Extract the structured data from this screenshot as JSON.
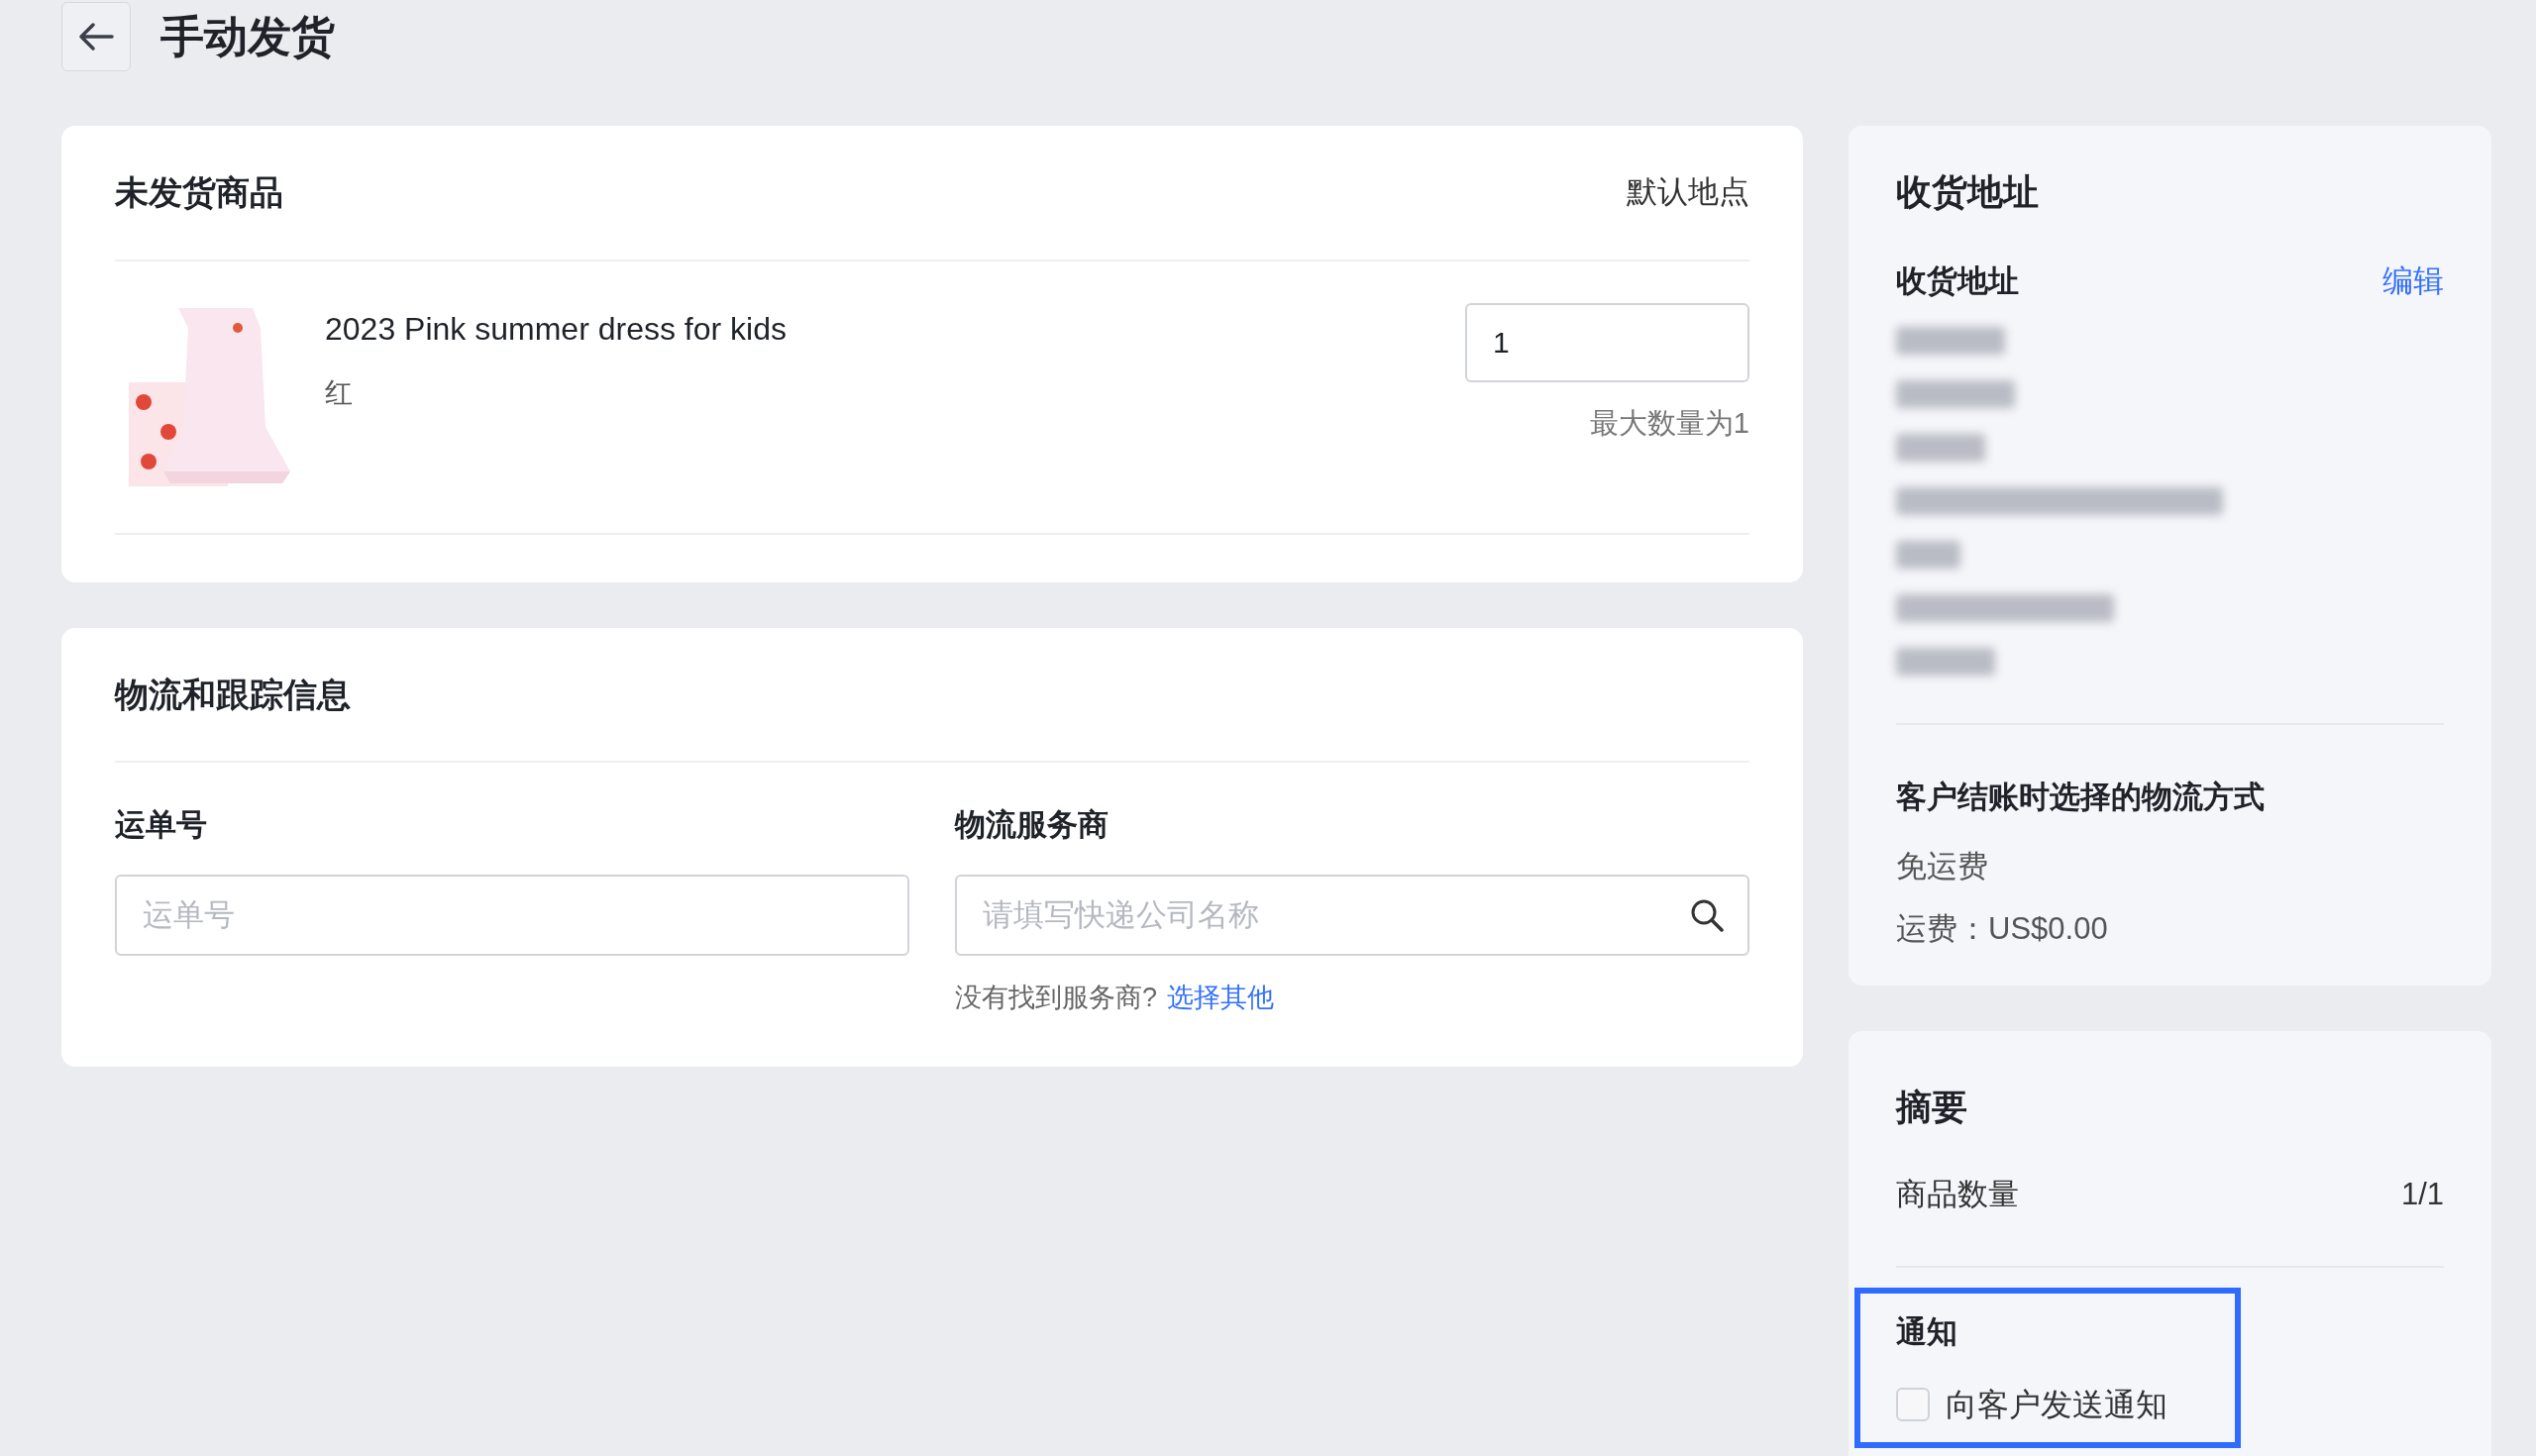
{
  "page": {
    "title": "手动发货"
  },
  "unfulfilled": {
    "title": "未发货商品",
    "location": "默认地点",
    "items": [
      {
        "name": "2023 Pink summer dress for kids",
        "variant": "红",
        "quantity": "1",
        "hint": "最大数量为1"
      }
    ]
  },
  "shipping": {
    "title": "物流和跟踪信息",
    "fields": [
      {
        "label": "运单号",
        "placeholder": "运单号",
        "kind": "text"
      },
      {
        "label": "物流服务商",
        "placeholder": "请填写快递公司名称",
        "kind": "search"
      }
    ],
    "hint": "没有找到服务商?",
    "hint_link": "选择其他"
  },
  "address": {
    "title": "收货地址",
    "heading": "收货地址",
    "edit": "编辑",
    "redacted": true,
    "method_title": "客户结账时选择的物流方式",
    "method": "免运费",
    "fee": "运费：US$0.00"
  },
  "summary": {
    "title": "摘要",
    "rows": [
      {
        "label": "商品数量",
        "value": "1/1"
      }
    ],
    "notify_title": "通知",
    "notify": {
      "label": "向客户发送通知",
      "checked": false
    },
    "highlighted": true
  }
}
